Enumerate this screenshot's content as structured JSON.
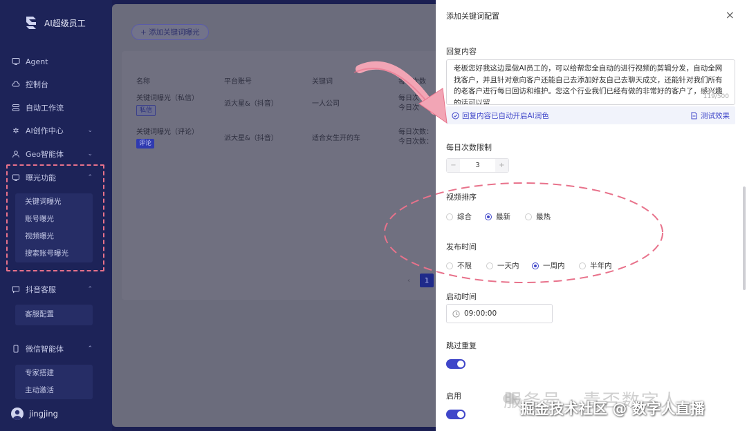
{
  "brand": {
    "name": "AI超级员工"
  },
  "sidebar": {
    "items": [
      {
        "label": "Agent",
        "icon": "monitor-icon"
      },
      {
        "label": "控制台",
        "icon": "cloud-icon"
      },
      {
        "label": "自动工作流",
        "icon": "workflow-icon"
      },
      {
        "label": "AI创作中心",
        "icon": "sparkle-icon"
      },
      {
        "label": "Geo智能体",
        "icon": "person-icon"
      },
      {
        "label": "曝光功能",
        "icon": "exposure-icon"
      },
      {
        "label": "抖音客服",
        "icon": "chat-icon"
      },
      {
        "label": "微信智能体",
        "icon": "phone-icon"
      }
    ],
    "exposure_sub": [
      "关键词曝光",
      "账号曝光",
      "视频曝光",
      "搜索账号曝光"
    ],
    "service_sub": [
      "客服配置"
    ],
    "wechat_sub": [
      "专家搭建",
      "主动激活"
    ],
    "user": "jingjing"
  },
  "main": {
    "add_button": "+ 添加关键词曝光",
    "headers": [
      "名称",
      "平台账号",
      "关键词",
      "每日次数"
    ],
    "rows": [
      {
        "name": "关键词曝光（私信）",
        "tag": "私信",
        "account": "派大星&（抖音）",
        "keyword": "一人公司",
        "daily": "每日次",
        "daily2": "今日次"
      },
      {
        "name": "关键词曝光（评论）",
        "tag": "评论",
        "account": "派大星&（抖音）",
        "keyword": "适合女生开的车",
        "daily": "每日次数：",
        "daily2": "今日次数："
      }
    ],
    "pager": {
      "prev": "‹",
      "current": "1"
    }
  },
  "drawer": {
    "title": "添加关键词配置",
    "close": "×",
    "reply_label": "回复内容",
    "reply_text": "老板您好我这边是做AI员工的，可以给帮您全自动的进行视频的剪辑分发，自动全网找客户，并且针对意向客户还能自己去添加好友自己去聊天成交，还能针对我们所有的老客户进行每日回访和维护。您这个行业我们已经有做的非常好的客户了，感兴趣的话可以留",
    "counter": "119/500",
    "ai_hint": "回复内容已自动开启AI润色",
    "test_effect": "测试效果",
    "daily_limit_label": "每日次数限制",
    "stepper": {
      "minus": "−",
      "value": "3",
      "plus": "+"
    },
    "sort_label": "视频排序",
    "sort_options": [
      "综合",
      "最新",
      "最热"
    ],
    "sort_selected": 1,
    "publish_label": "发布时间",
    "publish_options": [
      "不限",
      "一天内",
      "一周内",
      "半年内"
    ],
    "publish_selected": 2,
    "start_label": "启动时间",
    "start_time": "09:00:00",
    "skip_label": "跳过重复",
    "skip_on": true,
    "enable_label": "启用",
    "enable_on": true
  },
  "watermark": {
    "gray": "服务号 · 青否数字人",
    "white": "掘金技术社区 @ 数字人直播"
  },
  "colors": {
    "accent": "#3f46c9",
    "sidebar": "#1d2358",
    "annotation": "#e8728b"
  }
}
